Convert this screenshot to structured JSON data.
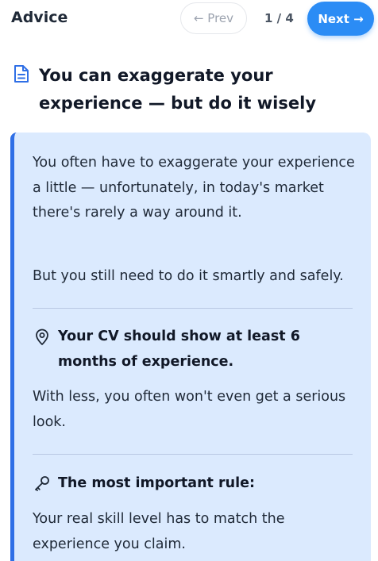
{
  "header": {
    "brand": "Advice",
    "prev_label": "← Prev",
    "page_indicator": "1 / 4",
    "next_label": "Next →"
  },
  "article": {
    "icon": "document-icon",
    "title": "You can exaggerate your experience — but do it wisely"
  },
  "card": {
    "accent_color": "#2f6fe6",
    "background_color": "#dbeafe",
    "intro_1": "You often have to exaggerate your experience a little — unfortunately, in today's market there's rarely a way around it.",
    "intro_2": "But you still need to do it smartly and safely.",
    "points": [
      {
        "icon": "location-pin-icon",
        "title": "Your CV should show at least 6 months of experience.",
        "body": "With less, you often won't even get a serious look."
      },
      {
        "icon": "key-icon",
        "title": "The most important rule:",
        "body": "Your real skill level has to match the experience you claim."
      }
    ]
  },
  "colors": {
    "primary_button": "#2b8cf5",
    "text": "#1f2937"
  }
}
